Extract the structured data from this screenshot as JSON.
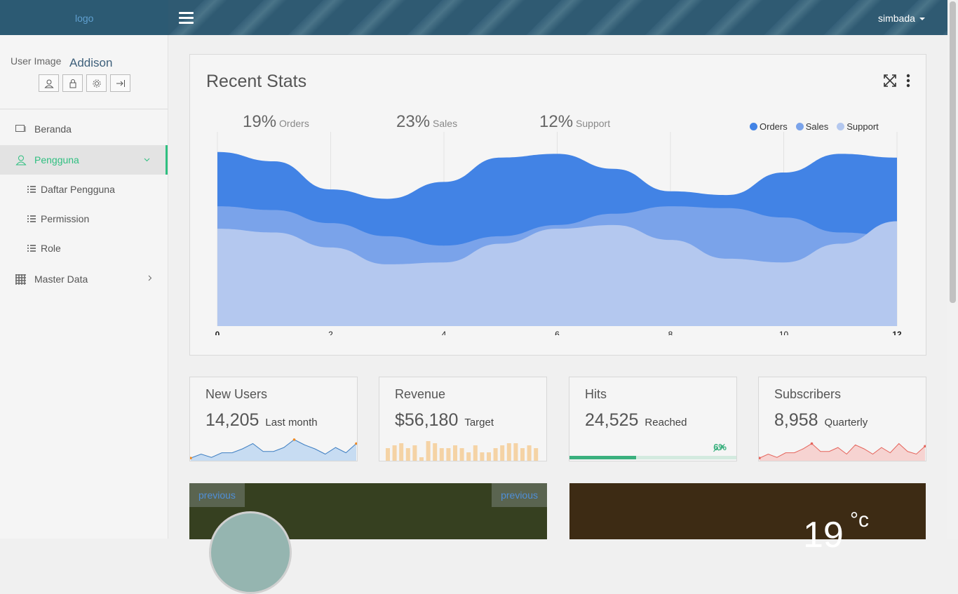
{
  "topbar": {
    "logo": "logo",
    "user": "simbada"
  },
  "sidebar": {
    "user_image": "User Image",
    "user_name": "Addison",
    "items": [
      {
        "label": "Beranda",
        "icon": "monitor-icon"
      },
      {
        "label": "Pengguna",
        "icon": "user-icon",
        "active": true
      },
      {
        "label": "Daftar Pengguna",
        "icon": "list-icon"
      },
      {
        "label": "Permission",
        "icon": "list-icon"
      },
      {
        "label": "Role",
        "icon": "list-icon"
      },
      {
        "label": "Master Data",
        "icon": "grid-icon"
      }
    ]
  },
  "recent_stats": {
    "title": "Recent Stats",
    "stats": [
      {
        "pct": "19%",
        "label": "Orders"
      },
      {
        "pct": "23%",
        "label": "Sales"
      },
      {
        "pct": "12%",
        "label": "Support"
      }
    ],
    "legend": [
      "Orders",
      "Sales",
      "Support"
    ]
  },
  "chart_data": {
    "type": "area",
    "x": [
      0,
      1,
      2,
      3,
      4,
      5,
      6,
      7,
      8,
      9,
      10,
      11,
      12
    ],
    "tick_labels": [
      "0",
      "2",
      "4",
      "6",
      "8",
      "10",
      "12"
    ],
    "series": [
      {
        "name": "Orders",
        "color": "#4283e5",
        "values": [
          93,
          88,
          73,
          68,
          77,
          90,
          92,
          84,
          72,
          70,
          82,
          92,
          90
        ]
      },
      {
        "name": "Sales",
        "color": "#7aa3ea",
        "values": [
          64,
          62,
          55,
          48,
          43,
          48,
          54,
          60,
          64,
          63,
          58,
          50,
          48
        ]
      },
      {
        "name": "Support",
        "color": "#b4c8ef",
        "values": [
          52,
          50,
          42,
          33,
          34,
          44,
          52,
          54,
          46,
          36,
          34,
          44,
          56
        ]
      }
    ],
    "ylim": [
      0,
      100
    ]
  },
  "cards": [
    {
      "title": "New Users",
      "value": "14,205",
      "sub": "Last month"
    },
    {
      "title": "Revenue",
      "value": "$56,180",
      "sub": "Target"
    },
    {
      "title": "Hits",
      "value": "24,525",
      "sub": "Reached",
      "pct": "6%",
      "progress": 0.4
    },
    {
      "title": "Subscribers",
      "value": "8,958",
      "sub": "Quarterly"
    }
  ],
  "sparklines": {
    "new_users": [
      2,
      8,
      3,
      10,
      10,
      16,
      24,
      12,
      12,
      18,
      30,
      22,
      16,
      8,
      18,
      10,
      24
    ],
    "revenue": [
      18,
      22,
      25,
      18,
      22,
      5,
      28,
      25,
      18,
      18,
      22,
      18,
      12,
      22,
      12,
      12,
      18,
      22,
      25,
      25,
      18,
      22,
      18
    ],
    "subscribers": [
      2,
      8,
      3,
      10,
      10,
      16,
      24,
      12,
      12,
      18,
      8,
      22,
      16,
      8,
      18,
      10,
      24,
      12,
      8,
      20
    ]
  },
  "bottom": {
    "prev1": "previous",
    "prev2": "previous",
    "temp": "19",
    "deg": "°c"
  }
}
